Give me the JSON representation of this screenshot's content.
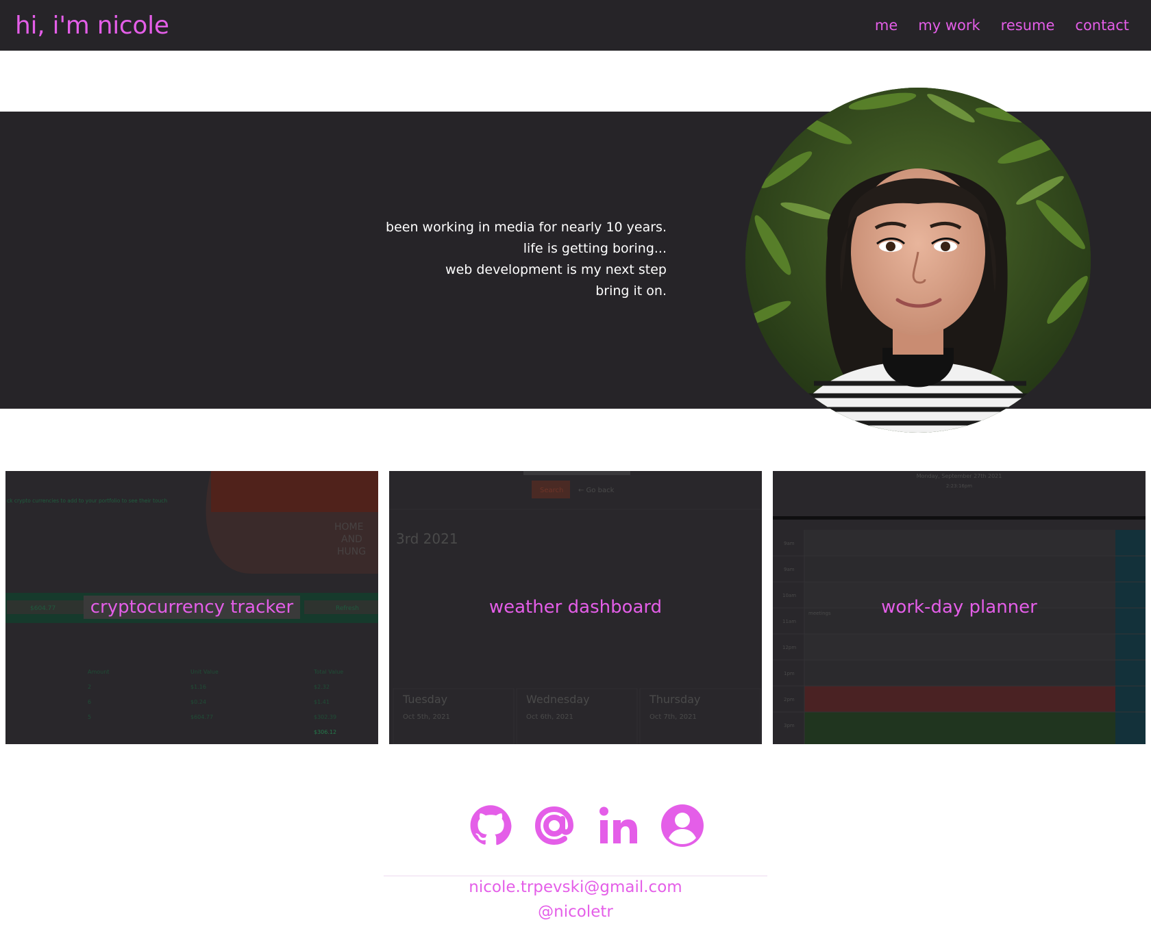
{
  "header": {
    "brand": "hi, i'm nicole",
    "nav": [
      "me",
      "my work",
      "resume",
      "contact"
    ]
  },
  "hero": {
    "bio_lines": [
      "been working in media for nearly 10 years.",
      "life is getting boring...",
      "web development is my next step",
      "bring it on."
    ]
  },
  "projects": [
    {
      "title": "cryptocurrency tracker"
    },
    {
      "title": "weather dashboard"
    },
    {
      "title": "work-day planner"
    }
  ],
  "contact": {
    "icons": [
      "github-icon",
      "at-icon",
      "linkedin-icon",
      "user-icon"
    ],
    "email": "nicole.trpevski@gmail.com",
    "handle": "@nicoletr"
  },
  "colors": {
    "accent": "#e45ee8",
    "dark": "#262428"
  },
  "screens": {
    "crypto": {
      "prompt": "ck crypto currencies to add to your portfolio to see their touch",
      "total_field": "$604.77",
      "refresh": "Refresh",
      "headers": [
        "Amount",
        "Unit Value",
        "Total Value"
      ],
      "rows": [
        [
          "2",
          "$1.16",
          "$2.32"
        ],
        [
          "6",
          "$0.24",
          "$1.41"
        ],
        [
          "5",
          "$604.77",
          "$302.39"
        ]
      ],
      "sum": "$306.12",
      "sign": [
        "HOME",
        "AND",
        "HUNG"
      ]
    },
    "weather": {
      "search": "Search",
      "go_back": "← Go back",
      "date": "3rd 2021",
      "days": [
        {
          "name": "Tuesday",
          "date": "Oct 5th, 2021"
        },
        {
          "name": "Wednesday",
          "date": "Oct 6th, 2021"
        },
        {
          "name": "Thursday",
          "date": "Oct 7th, 2021"
        }
      ]
    },
    "planner": {
      "date": "Monday, September 27th 2021",
      "time": "2:23:16pm",
      "hours": [
        "9am",
        "9am",
        "10am",
        "11am",
        "12pm",
        "1pm",
        "2pm",
        "3pm"
      ],
      "note": "meetings"
    }
  }
}
